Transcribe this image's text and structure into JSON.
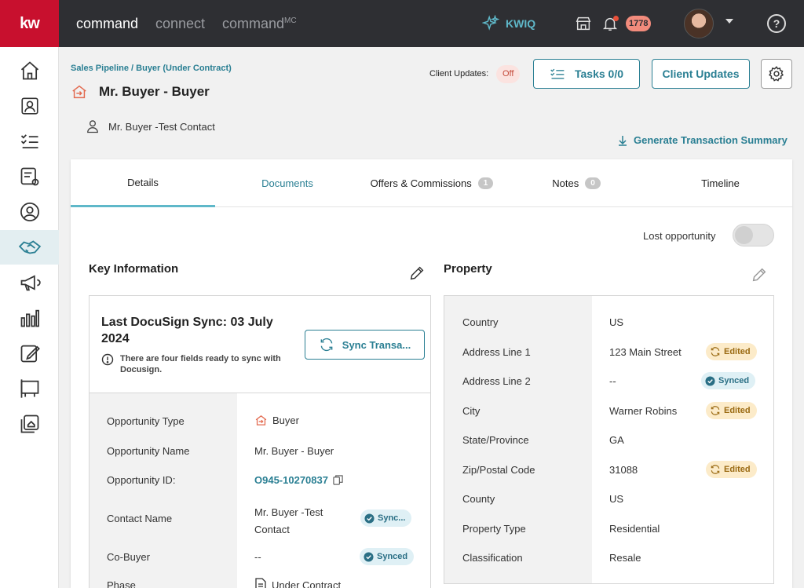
{
  "header": {
    "logo": "kw",
    "nav": [
      "command",
      "connect",
      "command",
      "MC"
    ],
    "kwiq_label": "KWIQ",
    "notification_count": "1778"
  },
  "breadcrumb": "Sales Pipeline / Buyer (Under Contract)",
  "page_title": "Mr. Buyer - Buyer",
  "contact": "Mr. Buyer -Test Contact",
  "client_updates": {
    "label": "Client Updates:",
    "status": "Off",
    "button": "Client Updates"
  },
  "tasks_button": "Tasks 0/0",
  "generate_summary": "Generate Transaction Summary",
  "tabs": [
    {
      "label": "Details"
    },
    {
      "label": "Documents"
    },
    {
      "label": "Offers & Commissions",
      "count": "1"
    },
    {
      "label": "Notes",
      "count": "0"
    },
    {
      "label": "Timeline"
    }
  ],
  "lost_opportunity_label": "Lost opportunity",
  "key_info": {
    "title": "Key Information",
    "sync_title": "Last DocuSign Sync: 03 July 2024",
    "sync_note": "There are four fields ready to sync with Docusign.",
    "sync_button": "Sync Transa...",
    "rows": [
      {
        "label": "Opportunity Type",
        "value": "Buyer"
      },
      {
        "label": "Opportunity Name",
        "value": "Mr. Buyer - Buyer"
      },
      {
        "label": "Opportunity ID:",
        "value": "O945-10270837"
      },
      {
        "label": "Contact Name",
        "value_line1": "Mr. Buyer -Test",
        "value_line2": "Contact",
        "badge": "Sync..."
      },
      {
        "label": "Co-Buyer",
        "value": "--",
        "badge": "Synced"
      },
      {
        "label": "Phase",
        "value": "Under Contract"
      }
    ]
  },
  "property": {
    "title": "Property",
    "rows": [
      {
        "label": "Country",
        "value": "US"
      },
      {
        "label": "Address Line 1",
        "value": "123 Main Street",
        "badge": "Edited"
      },
      {
        "label": "Address Line 2",
        "value": "--",
        "badge": "Synced"
      },
      {
        "label": "City",
        "value": "Warner Robins",
        "badge": "Edited"
      },
      {
        "label": "State/Province",
        "value": "GA"
      },
      {
        "label": "Zip/Postal Code",
        "value": "31088",
        "badge": "Edited"
      },
      {
        "label": "County",
        "value": "US"
      },
      {
        "label": "Property Type",
        "value": "Residential"
      },
      {
        "label": "Classification",
        "value": "Resale"
      }
    ]
  },
  "colors": {
    "brand_red": "#c8102e",
    "accent_teal": "#2a7f93",
    "topbar": "#2e2f33"
  }
}
